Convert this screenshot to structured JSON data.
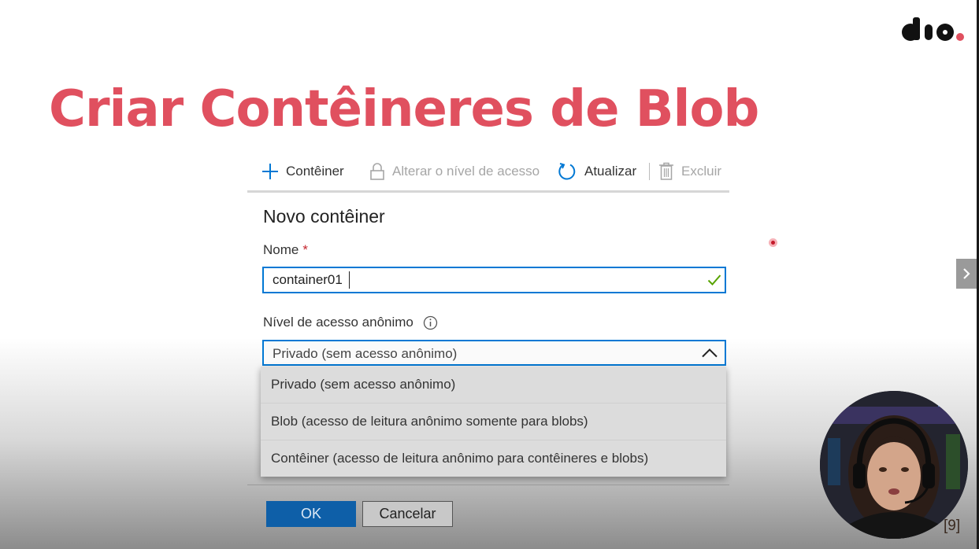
{
  "slide": {
    "title": "Criar Contêineres de Blob",
    "page_number": "[9]",
    "brand_logo_text": "dio",
    "accent_color": "#e0505f"
  },
  "toolbar": {
    "add_container_label": "Contêiner",
    "change_access_label": "Alterar o nível de acesso",
    "refresh_label": "Atualizar",
    "delete_label": "Excluir"
  },
  "panel": {
    "title": "Novo contêiner",
    "name_label": "Nome",
    "required_marker": "*",
    "name_value": "container01",
    "access_label": "Nível de acesso anônimo",
    "access_selected": "Privado (sem acesso anônimo)",
    "access_options": [
      "Privado (sem acesso anônimo)",
      "Blob (acesso de leitura anônimo somente para blobs)",
      "Contêiner (acesso de leitura anônimo para contêineres e blobs)"
    ],
    "ok_label": "OK",
    "cancel_label": "Cancelar"
  },
  "icons": {
    "add": "plus-icon",
    "lock": "lock-icon",
    "refresh": "refresh-icon",
    "delete": "trash-icon",
    "valid": "checkmark-icon",
    "info": "info-icon",
    "chevron": "chevron-up-icon",
    "next": "chevron-right-icon"
  },
  "colors": {
    "primary_blue": "#0078d4",
    "ok_button": "#0e5fa8",
    "check_green": "#57a300",
    "required_red": "#c4262e"
  }
}
